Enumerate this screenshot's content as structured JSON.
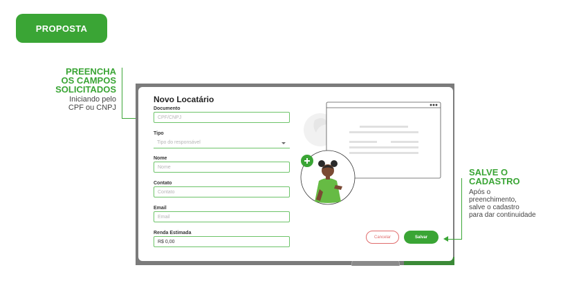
{
  "badge": {
    "label": "PROPOSTA"
  },
  "annotations": {
    "left": {
      "title_lines": [
        "PREENCHA",
        "OS CAMPOS",
        "SOLICITADOS"
      ],
      "sub_lines": [
        "Iniciando pelo",
        "CPF ou CNPJ"
      ]
    },
    "right": {
      "title_lines": [
        "SALVE O",
        "CADASTRO"
      ],
      "sub_lines": [
        "Após o",
        "preenchimento,",
        "salve o cadastro",
        "para dar continuidade"
      ]
    }
  },
  "modal": {
    "title": "Novo Locatário",
    "fields": {
      "documento": {
        "label": "Documento",
        "placeholder": "CPF/CNPJ"
      },
      "tipo": {
        "label": "Tipo",
        "placeholder": "Tipo do responsável"
      },
      "nome": {
        "label": "Nome",
        "placeholder": "Nome"
      },
      "contato": {
        "label": "Contato",
        "placeholder": "Contato"
      },
      "email": {
        "label": "Email",
        "placeholder": "Email"
      },
      "renda": {
        "label": "Renda Estimada",
        "value": "R$ 0,00"
      }
    },
    "buttons": {
      "cancel": "Cancelar",
      "save": "Salvar"
    }
  },
  "colors": {
    "accent": "#3aa535",
    "cancel": "#e06b6b",
    "field_border": "#6cc368"
  },
  "icons": [
    "plus-icon",
    "window-dots-icon",
    "chevron-down-icon",
    "person-illustration"
  ]
}
